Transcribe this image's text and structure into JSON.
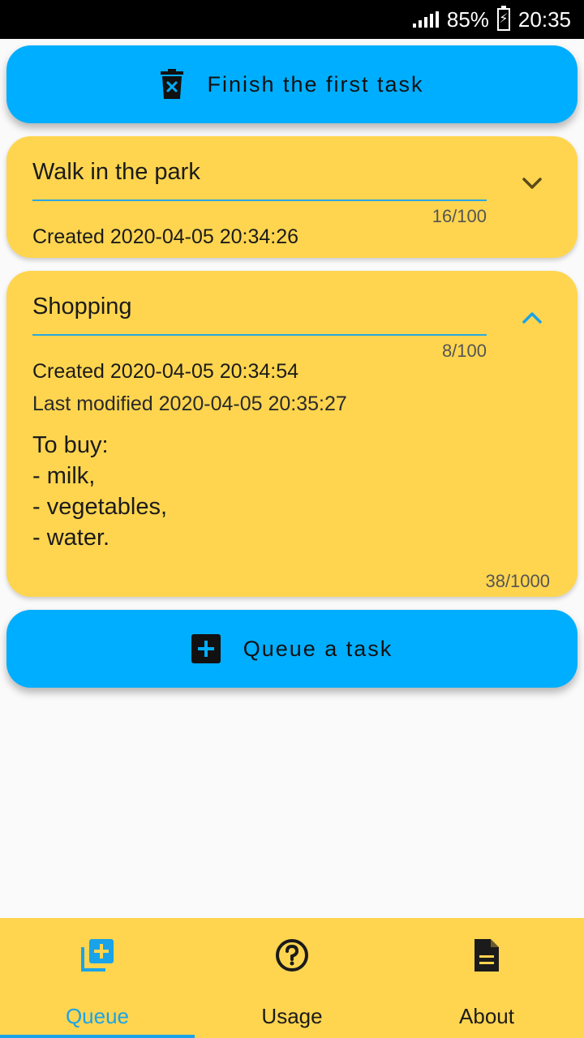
{
  "status": {
    "battery": "85%",
    "time": "20:35"
  },
  "finish_button": {
    "label": "Finish the first task",
    "icon": "trash-x-icon"
  },
  "tasks": [
    {
      "title": "Walk in the park",
      "title_counter": "16/100",
      "created": "Created 2020-04-05 20:34:26",
      "expanded": false
    },
    {
      "title": "Shopping",
      "title_counter": "8/100",
      "created": "Created 2020-04-05 20:34:54",
      "modified": "Last modified 2020-04-05 20:35:27",
      "description": "To buy:\n- milk,\n- vegetables,\n- water.",
      "description_counter": "38/1000",
      "expanded": true
    }
  ],
  "queue_button": {
    "label": "Queue a task",
    "icon": "add-box-icon"
  },
  "nav": [
    {
      "label": "Queue",
      "icon": "queue-add-icon",
      "active": true
    },
    {
      "label": "Usage",
      "icon": "help-circle-icon",
      "active": false
    },
    {
      "label": "About",
      "icon": "document-icon",
      "active": false
    }
  ],
  "colors": {
    "accent": "#00aeff",
    "card": "#ffd54f",
    "active_nav": "#1aa3e8"
  }
}
